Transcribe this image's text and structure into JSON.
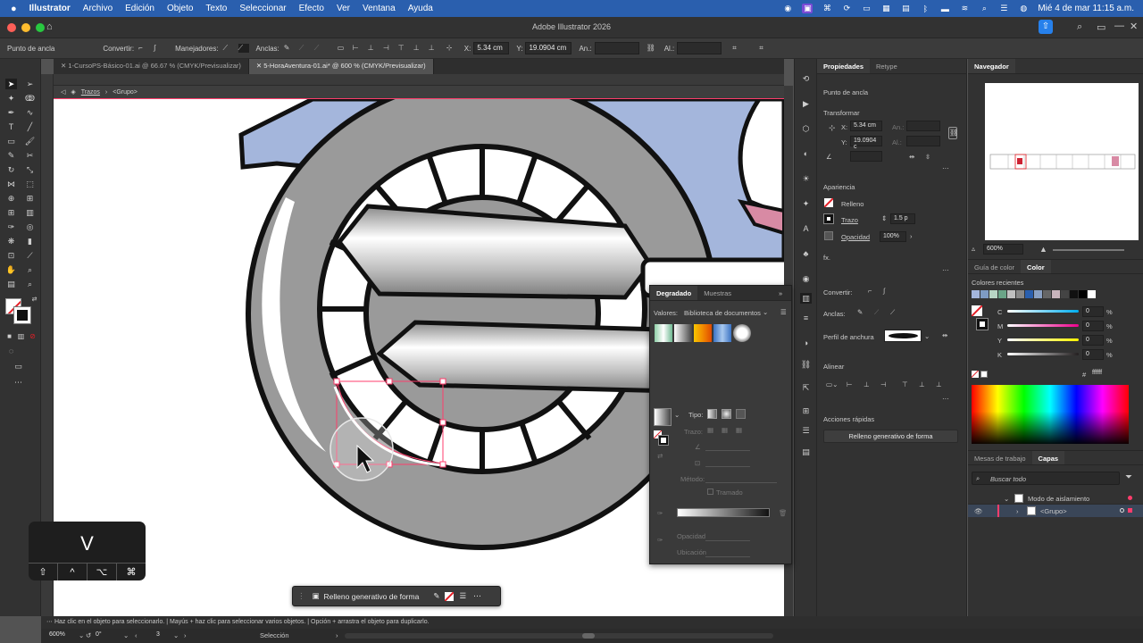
{
  "menubar": {
    "app": "Illustrator",
    "items": [
      "Archivo",
      "Edición",
      "Objeto",
      "Texto",
      "Seleccionar",
      "Efecto",
      "Ver",
      "Ventana",
      "Ayuda"
    ],
    "datetime": "Mié 4 de mar  11:15 a.m."
  },
  "window": {
    "title": "Adobe Illustrator 2026"
  },
  "controlbar": {
    "mode": "Punto de ancla",
    "convert_label": "Convertir:",
    "handles_label": "Manejadores:",
    "anchors_label": "Anclas:",
    "x_label": "X:",
    "x_value": "5.34 cm",
    "y_label": "Y:",
    "y_value": "19.0904 cm",
    "w_label": "An.:",
    "h_label": "Al.:"
  },
  "tabs": [
    {
      "label": "1-CursoPS-Básico-01.ai @ 66.67 % (CMYK/Previsualizar)",
      "active": false
    },
    {
      "label": "5-HoraAventura-01.ai* @ 600 % (CMYK/Previsualizar)",
      "active": true
    }
  ],
  "breadcrumb": {
    "layer": "Trazos",
    "group": "<Grupo>"
  },
  "properties": {
    "tabs": [
      "Propiedades",
      "Retype"
    ],
    "section_anchor": "Punto de ancla",
    "transform_title": "Transformar",
    "x_label": "X:",
    "x_value": "5.34 cm",
    "y_label": "Y:",
    "y_value": "19.0904 c",
    "w_label": "An.:",
    "h_label": "Al.:",
    "appearance_title": "Apariencia",
    "fill_label": "Relleno",
    "stroke_label": "Trazo",
    "stroke_value": "1.5 p",
    "opacity_label": "Opacidad",
    "opacity_value": "100%",
    "fx_label": "fx.",
    "convert_label": "Convertir:",
    "anchors_label": "Anclas:",
    "width_profile_label": "Perfil de anchura",
    "align_title": "Alinear",
    "quick_actions_title": "Acciones rápidas",
    "quick_action_button": "Relleno generativo de forma"
  },
  "gradient_panel": {
    "tabs": [
      "Degradado",
      "Muestras"
    ],
    "values_label": "Valores:",
    "values_select": "Biblioteca de documentos",
    "type_label": "Tipo:",
    "stroke_label": "Trazo:",
    "method_label": "Método:",
    "dither_label": "Tramado",
    "opacity_label": "Opacidad",
    "location_label": "Ubicación"
  },
  "navigator": {
    "title": "Navegador",
    "zoom": "600%"
  },
  "color_panel": {
    "tabs": [
      "Guía de color",
      "Color"
    ],
    "recent_label": "Colores recientes",
    "channels": [
      {
        "name": "C",
        "value": "0",
        "unit": "%",
        "color": "#00aeef"
      },
      {
        "name": "M",
        "value": "0",
        "unit": "%",
        "color": "#ec008c"
      },
      {
        "name": "Y",
        "value": "0",
        "unit": "%",
        "color": "#fff200"
      },
      {
        "name": "K",
        "value": "0",
        "unit": "%",
        "color": "#231f20"
      }
    ],
    "hex_value": "ffffff"
  },
  "layers_panel": {
    "tabs": [
      "Mesas de trabajo",
      "Capas"
    ],
    "search_placeholder": "Buscar todo",
    "rows": [
      "Modo de aislamiento",
      "<Grupo>"
    ]
  },
  "context_bar": {
    "label": "Relleno generativo de forma"
  },
  "key_overlay": {
    "key": "V",
    "modifiers": [
      "⇧",
      "^",
      "⌥",
      "⌘"
    ]
  },
  "statusbar": {
    "hint": "Haz clic en el objeto para seleccionarlo.  |  Mayús + haz clic para seleccionar varios objetos.  |  Opción + arrastra el objeto para duplicarlo.",
    "zoom": "600%",
    "angle": "0°",
    "artboard": "3",
    "tool": "Selección"
  },
  "colors": {
    "accent": "#2a5fae",
    "selection": "#ff3d6c",
    "panel": "#323232"
  }
}
